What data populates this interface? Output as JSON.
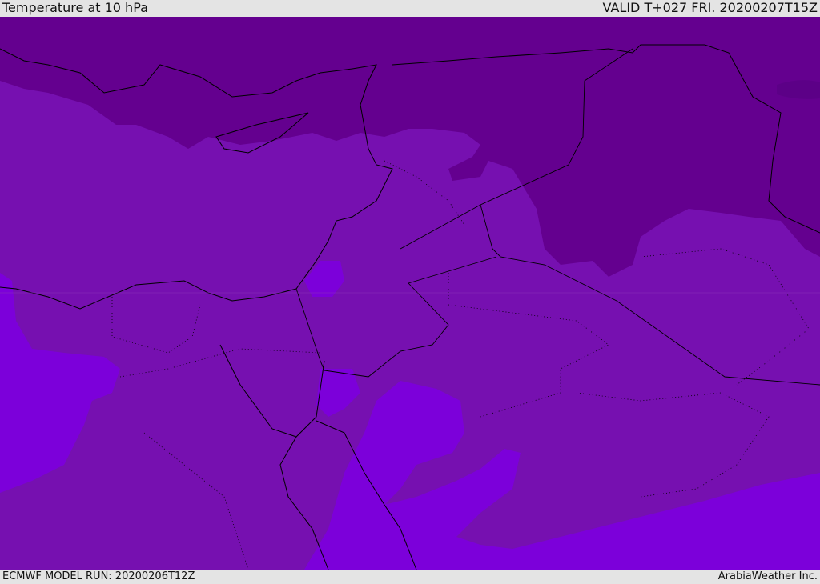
{
  "header": {
    "title": "Temperature at 10 hPa",
    "valid": "VALID T+027 FRI. 20200207T15Z"
  },
  "footer": {
    "model_run": "ECMWF MODEL RUN: 20200206T12Z",
    "credit": "ArabiaWeather Inc."
  },
  "colors": {
    "cold": "#64008f",
    "mid": "#7610b0",
    "warm": "#7c00da",
    "coast": "#000000"
  }
}
